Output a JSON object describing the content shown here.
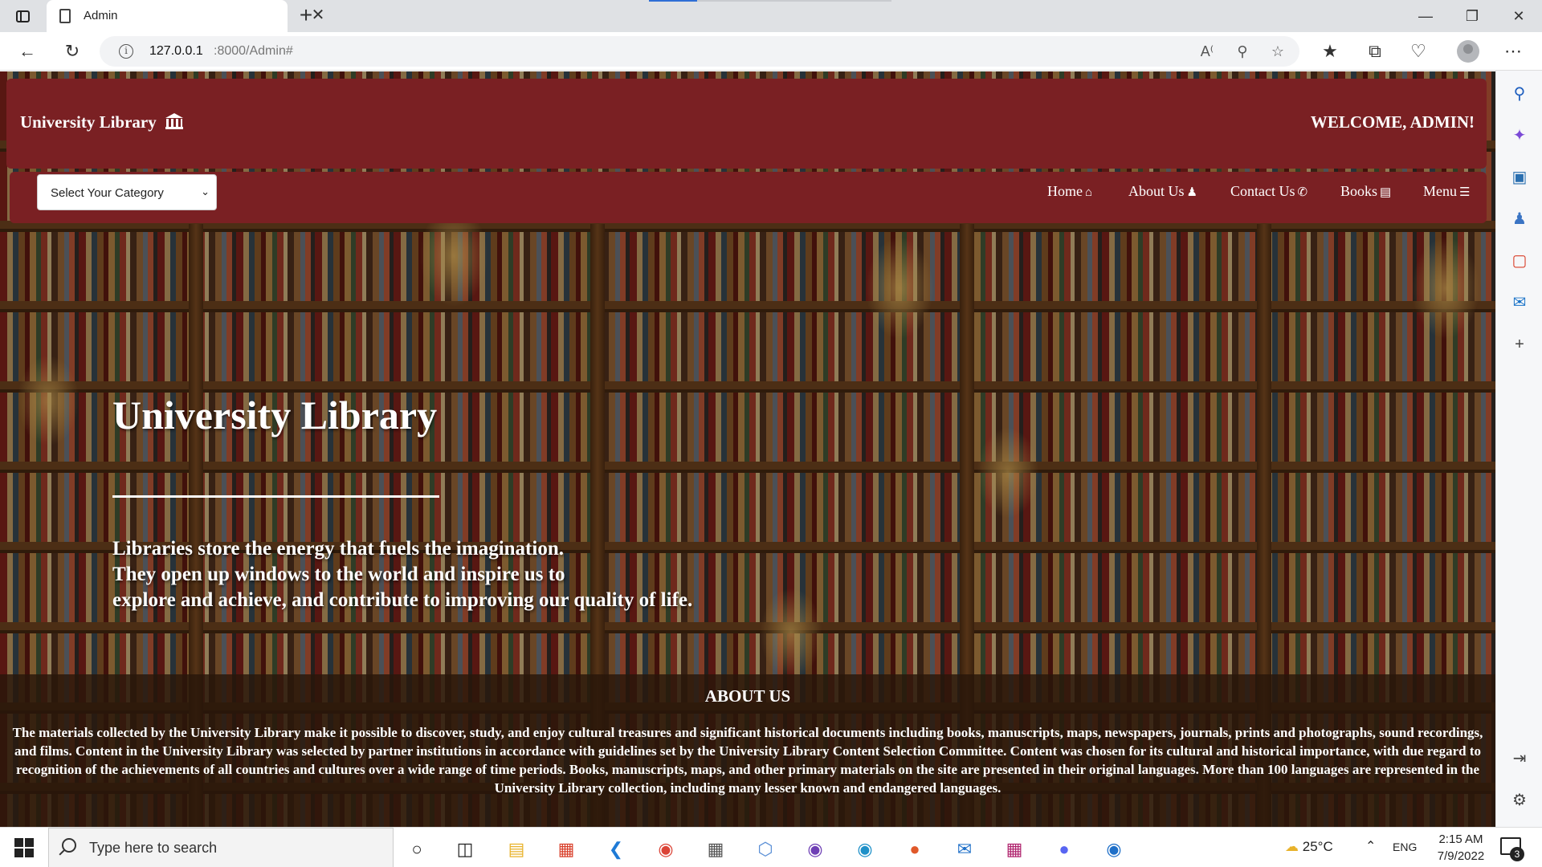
{
  "browser": {
    "tab_title": "Admin",
    "url_host": "127.0.0.1",
    "url_path": ":8000/Admin#",
    "new_tab_symbol": "+",
    "close_symbol": "✕"
  },
  "header": {
    "brand": "University Library",
    "welcome": "WELCOME, ADMIN!",
    "category_select": "Select Your Category",
    "nav": {
      "home": "Home",
      "about": "About Us",
      "contact": "Contact Us",
      "books": "Books",
      "menu": "Menu"
    }
  },
  "hero": {
    "title": "University Library",
    "lines": [
      "Libraries store the energy that fuels the imagination.",
      "They open up windows to the world and inspire us to",
      "explore and achieve, and contribute to improving our quality of life."
    ]
  },
  "about": {
    "heading": "ABOUT US",
    "body": "The materials collected by the University Library make it possible to discover, study, and enjoy cultural treasures and significant historical documents including books, manuscripts, maps, newspapers, journals, prints and photographs, sound recordings, and films. Content in the University Library was selected by partner institutions in accordance with guidelines set by the University Library Content Selection Committee. Content was chosen for its cultural and historical importance, with due regard to recognition of the achievements of all countries and cultures over a wide range of time periods. Books, manuscripts, maps, and other primary materials on the site are presented in their original languages. More than 100 languages are represented in the University Library collection, including many lesser known and endangered languages."
  },
  "taskbar": {
    "search_placeholder": "Type here to search",
    "weather": "25°C",
    "language": "ENG",
    "time": "2:15 AM",
    "date": "7/9/2022",
    "notifications": "3"
  },
  "colors": {
    "header_bg": "#7a2023",
    "text": "#ffffff",
    "about_bg": "#28160a"
  }
}
